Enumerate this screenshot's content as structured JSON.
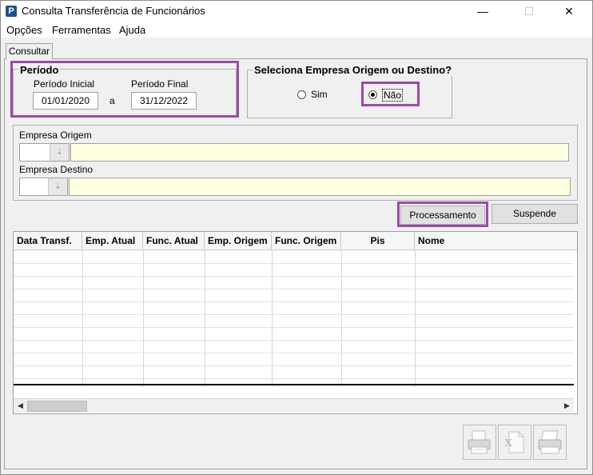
{
  "window": {
    "title": "Consulta Transferência de Funcionários",
    "controls": {
      "minimize": "—",
      "maximize": "☐",
      "close": "✕"
    }
  },
  "menu": {
    "items": [
      "Opções",
      "Ferramentas",
      "Ajuda"
    ]
  },
  "tabs": [
    {
      "label": "Consultar",
      "active": true
    }
  ],
  "periodo": {
    "title": "Período",
    "inicial_label": "Período Inicial",
    "inicial_value": "01/01/2020",
    "separator": "a",
    "final_label": "Período Final",
    "final_value": "31/12/2022"
  },
  "empresa_select": {
    "title": "Seleciona Empresa Origem ou Destino?",
    "options": [
      {
        "label": "Sim",
        "selected": false
      },
      {
        "label": "Não",
        "selected": true
      }
    ]
  },
  "empresas": {
    "origem_label": "Empresa Origem",
    "destino_label": "Empresa Destino"
  },
  "buttons": {
    "processamento": "Processamento",
    "suspende": "Suspende"
  },
  "grid": {
    "columns": [
      "Data Transf.",
      "Emp. Atual",
      "Func. Atual",
      "Emp. Origem",
      "Func. Origem",
      "Pis",
      "Nome"
    ],
    "rows": []
  },
  "bottom_buttons": [
    "print-icon",
    "excel-icon",
    "printer-icon"
  ],
  "colors": {
    "highlight": "#9a4aaa",
    "lookup_field": "#ffffe1",
    "app_icon": "#1e4f8c"
  }
}
